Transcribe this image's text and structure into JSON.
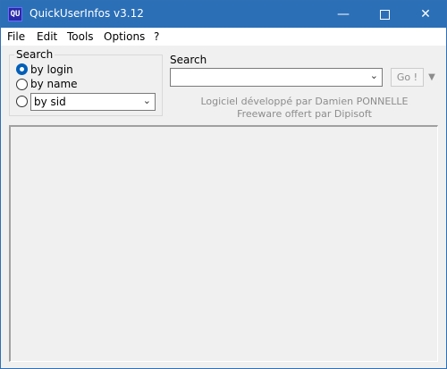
{
  "window": {
    "title": "QuickUserInfos v3.12",
    "icon_text": "QU",
    "controls": [
      "minimize-icon",
      "maximize-icon",
      "close-icon"
    ]
  },
  "menu": {
    "items": [
      "File",
      "Edit",
      "Tools",
      "Options",
      "?"
    ]
  },
  "search_by": {
    "label": "Search",
    "options": [
      {
        "label": "by login",
        "checked": true
      },
      {
        "label": "by name",
        "checked": false
      },
      {
        "label": "",
        "checked": false
      }
    ],
    "sid_combo_value": "by sid"
  },
  "search": {
    "label": "Search",
    "value": "",
    "go_label": "Go !"
  },
  "credits": {
    "line1": "Logiciel développé par Damien PONNELLE",
    "line2": "Freeware offert par Dipisoft"
  },
  "colors": {
    "titlebar": "#2b6fb7",
    "radio_selected": "#005fb8",
    "credit_text": "#8c8c8c"
  }
}
